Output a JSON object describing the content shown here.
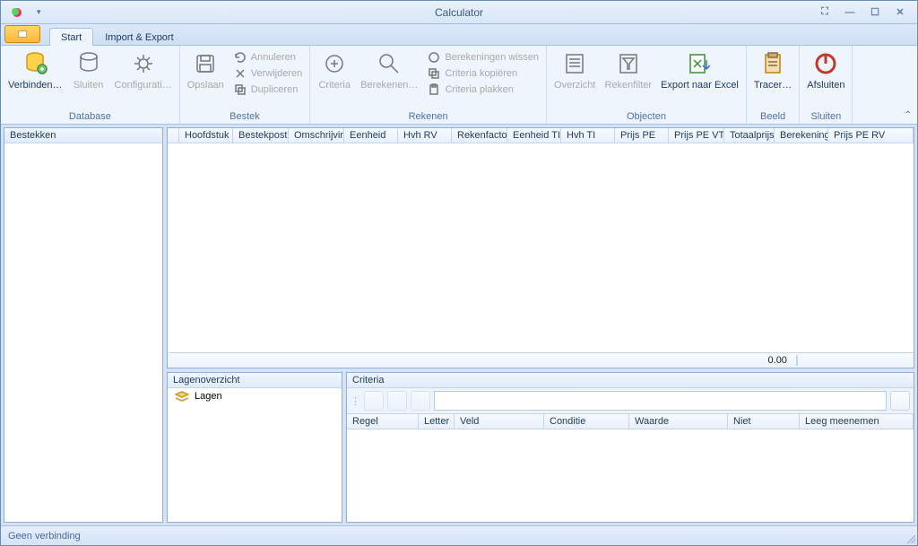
{
  "window": {
    "title": "Calculator"
  },
  "qat": {
    "dropdown_glyph": "▾"
  },
  "tabs": [
    {
      "label": "Start",
      "active": true
    },
    {
      "label": "Import & Export",
      "active": false
    }
  ],
  "ribbon": {
    "groups": {
      "database": {
        "label": "Database",
        "verbinden": "Verbinden…",
        "sluiten": "Sluiten",
        "configuratie": "Configurati…"
      },
      "bestek": {
        "label": "Bestek",
        "opslaan": "Opslaan",
        "annuleren": "Annuleren",
        "verwijderen": "Verwijderen",
        "dupliceren": "Dupliceren"
      },
      "rekenen": {
        "label": "Rekenen",
        "criteria": "Criteria",
        "berekenen": "Berekenen…",
        "wissen": "Berekeningen wissen",
        "kopieren": "Criteria kopiëren",
        "plakken": "Criteria plakken"
      },
      "objecten": {
        "label": "Objecten",
        "overzicht": "Overzicht",
        "rekenfilter": "Rekenfilter",
        "export": "Export naar Excel"
      },
      "beeld": {
        "label": "Beeld",
        "tracer": "Tracer…"
      },
      "sluiten": {
        "label": "Sluiten",
        "afsluiten": "Afsluiten"
      }
    }
  },
  "left_panel": {
    "title": "Bestekken"
  },
  "main_grid": {
    "columns": [
      "Hoofdstuk",
      "Bestekpost",
      "Omschrijving",
      "Eenheid",
      "Hvh RV",
      "Rekenfactor",
      "Eenheid TI",
      "Hvh TI",
      "Prijs PE",
      "Prijs PE VTOV",
      "Totaalprijs",
      "Berekening",
      "Prijs PE RV"
    ],
    "footer_total": "0.00"
  },
  "lagen_panel": {
    "title": "Lagenoverzicht",
    "root": "Lagen"
  },
  "criteria_panel": {
    "title": "Criteria",
    "columns": [
      "Regel",
      "Letter",
      "Veld",
      "Conditie",
      "Waarde",
      "Niet",
      "Leeg meenemen"
    ],
    "filter_value": ""
  },
  "statusbar": {
    "text": "Geen verbinding"
  },
  "win_controls": {
    "focus": "⛶",
    "minimize": "—",
    "maximize": "☐",
    "close": "✕"
  },
  "chevron": "⌃"
}
